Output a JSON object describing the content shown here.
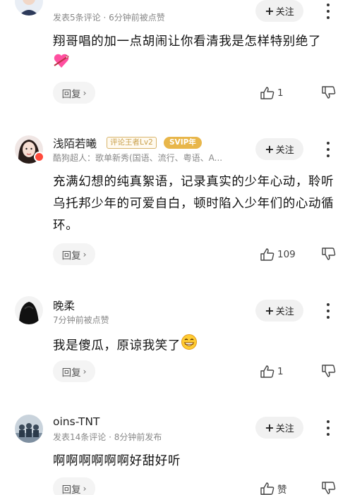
{
  "comments": [
    {
      "username": "",
      "subline": "发表5条评论 · 6分钟前被点赞",
      "follow": "关注",
      "text": "翔哥唱的加一点胡闹让你看清我是怎样特别绝了",
      "reply": "回复",
      "likes": "1",
      "avatar_icon": "avatar-partial-icon",
      "emoji_icon": "heart-emoji-icon"
    },
    {
      "username": "浅陌若曦",
      "tags": [
        "评论王者Lv2",
        "SVIP年"
      ],
      "subline": "酷狗超人：歌单新秀(国语、流行、粤语、A...",
      "follow": "关注",
      "text": "充满幻想的纯真絮语，记录真实的少年心动，聆听乌托邦少年的可爱自白，顿时陷入少年们的心动循环。",
      "reply": "回复",
      "likes": "109",
      "avatar_icon": "avatar-girl-icon"
    },
    {
      "username": "晚柔",
      "subline": "7分钟前被点赞",
      "follow": "关注",
      "text": "我是傻瓜，原谅我笑了",
      "reply": "回复",
      "likes": "1",
      "avatar_icon": "avatar-dark-icon",
      "emoji_icon": "grin-emoji-icon"
    },
    {
      "username": "oins-TNT",
      "subline": "发表14条评论 · 8分钟前发布",
      "follow": "关注",
      "text": "啊啊啊啊啊啊好甜好听",
      "reply": "回复",
      "likes": "赞",
      "avatar_icon": "avatar-group-icon"
    }
  ],
  "colors": {
    "accent_red": "#ff4a3c",
    "tag_gold": "#c9a04c",
    "svip_gold": "#e8b64a",
    "muted_text": "#888888"
  }
}
